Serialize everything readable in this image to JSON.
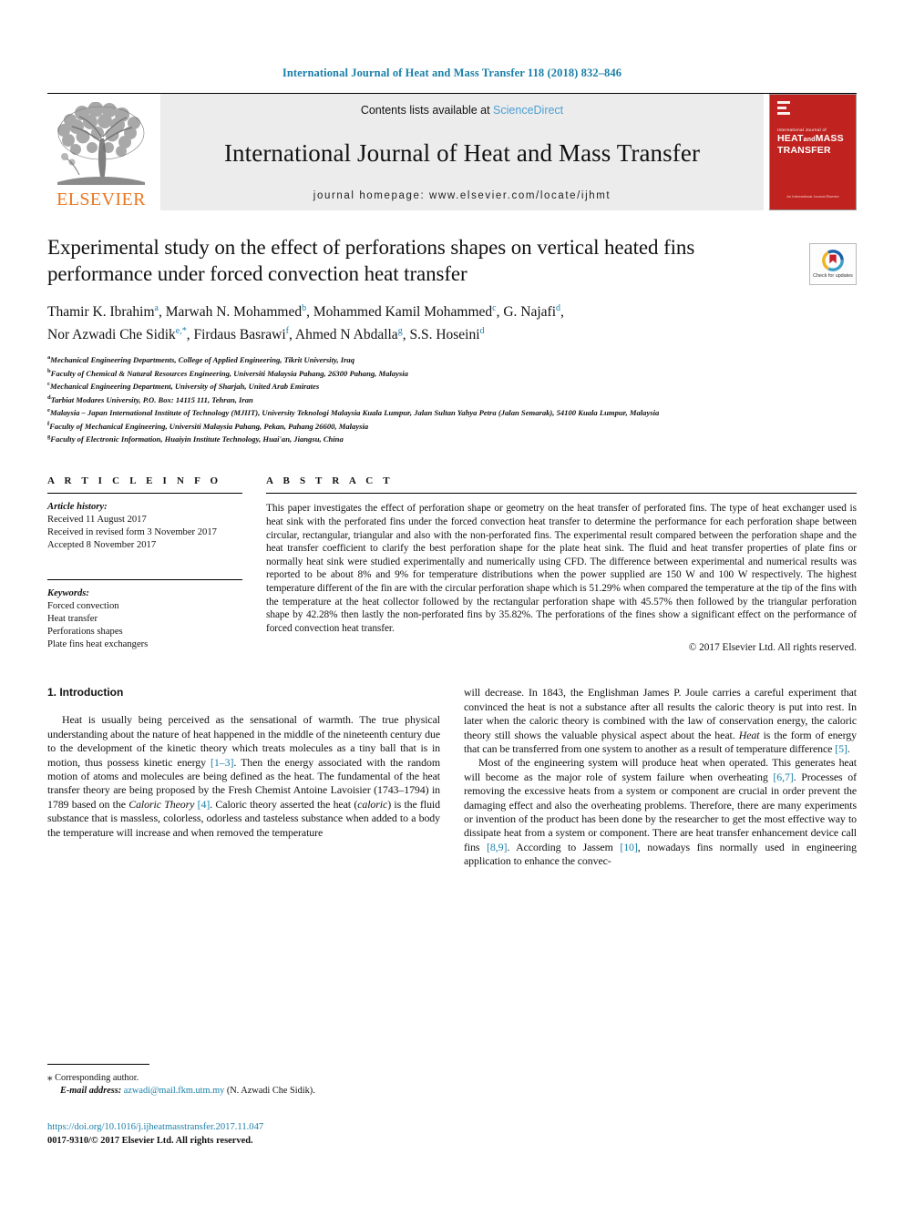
{
  "running_head": "International Journal of Heat and Mass Transfer 118 (2018) 832–846",
  "masthead": {
    "contents_prefix": "Contents lists available at ",
    "sciencedirect": "ScienceDirect",
    "journal_title": "International Journal of Heat and Mass Transfer",
    "homepage": "journal homepage: www.elsevier.com/locate/ijhmt",
    "publisher_logo_text": "ELSEVIER",
    "cover": {
      "small_line": "International Journal of",
      "line1": "HEAT",
      "line1b": "and",
      "line1c": "MASS",
      "line2": "TRANSFER",
      "footer": "An International Journal\nElsevier"
    }
  },
  "article": {
    "title": "Experimental study on the effect of perforations shapes on vertical heated fins performance under forced convection heat transfer",
    "crossmark_label": "Check for\nupdates",
    "authors": [
      {
        "name": "Thamir K. Ibrahim",
        "sup": "a"
      },
      {
        "name": "Marwah N. Mohammed",
        "sup": "b"
      },
      {
        "name": "Mohammed Kamil Mohammed",
        "sup": "c"
      },
      {
        "name": "G. Najafi",
        "sup": "d"
      },
      {
        "name": "Nor Azwadi Che Sidik",
        "sup": "e,*"
      },
      {
        "name": "Firdaus Basrawi",
        "sup": "f"
      },
      {
        "name": "Ahmed N Abdalla",
        "sup": "g"
      },
      {
        "name": "S.S. Hoseini",
        "sup": "d"
      }
    ],
    "affiliations": [
      {
        "mark": "a",
        "text": "Mechanical Engineering Departments, College of Applied Engineering, Tikrit University, Iraq"
      },
      {
        "mark": "b",
        "text": "Faculty of Chemical & Natural Resources Engineering, Universiti Malaysia Pahang, 26300 Pahang, Malaysia"
      },
      {
        "mark": "c",
        "text": "Mechanical Engineering Department, University of Sharjah, United Arab Emirates"
      },
      {
        "mark": "d",
        "text": "Tarbiat Modares University, P.O. Box: 14115 111, Tehran, Iran"
      },
      {
        "mark": "e",
        "text": "Malaysia – Japan International Institute of Technology (MJIIT), University Teknologi Malaysia Kuala Lumpur, Jalan Sultan Yahya Petra (Jalan Semarak), 54100 Kuala Lumpur, Malaysia"
      },
      {
        "mark": "f",
        "text": "Faculty of Mechanical Engineering, Universiti Malaysia Pahang, Pekan, Pahang 26600, Malaysia"
      },
      {
        "mark": "g",
        "text": "Faculty of Electronic Information, Huaiyin Institute Technology, Huai'an, Jiangsu, China"
      }
    ]
  },
  "article_info": {
    "heading": "A R T I C L E   I N F O",
    "history_label": "Article history:",
    "history": [
      "Received 11 August 2017",
      "Received in revised form 3 November 2017",
      "Accepted 8 November 2017"
    ],
    "keywords_label": "Keywords:",
    "keywords": [
      "Forced convection",
      "Heat transfer",
      "Perforations shapes",
      "Plate fins heat exchangers"
    ]
  },
  "abstract": {
    "heading": "A B S T R A C T",
    "text": "This paper investigates the effect of perforation shape or geometry on the heat transfer of perforated fins. The type of heat exchanger used is heat sink with the perforated fins under the forced convection heat transfer to determine the performance for each perforation shape between circular, rectangular, triangular and also with the non-perforated fins. The experimental result compared between the perforation shape and the heat transfer coefficient to clarify the best perforation shape for the plate heat sink. The fluid and heat transfer properties of plate fins or normally heat sink were studied experimentally and numerically using CFD. The difference between experimental and numerical results was reported to be about 8% and 9% for temperature distributions when the power supplied are 150 W and 100 W respectively. The highest temperature different of the fin are with the circular perforation shape which is 51.29% when compared the temperature at the tip of the fins with the temperature at the heat collector followed by the rectangular perforation shape with 45.57% then followed by the triangular perforation shape by 42.28% then lastly the non-perforated fins by 35.82%. The perforations of the fines show a significant effect on the performance of forced convection heat transfer.",
    "copyright": "© 2017 Elsevier Ltd. All rights reserved."
  },
  "introduction": {
    "section_number_title": "1. Introduction",
    "left_para1_a": "Heat is usually being perceived as the sensational of warmth. The true physical understanding about the nature of heat happened in the middle of the nineteenth century due to the development of the kinetic theory which treats molecules as a tiny ball that is in motion, thus possess kinetic energy ",
    "left_ref1": "[1–3]",
    "left_para1_b": ". Then the energy associated with the random motion of atoms and molecules are being defined as the heat. The fundamental of the heat transfer theory are being proposed by the Fresh Chemist Antoine Lavoisier (1743–1794) in 1789 based on the ",
    "left_italic1": "Caloric Theory",
    "left_ref2": "[4]",
    "left_para1_c": ". Caloric theory asserted the heat (",
    "left_italic2": "caloric",
    "left_para1_d": ") is the fluid substance that is massless, colorless, odorless and tasteless substance when added to a body the temperature will increase and when removed the temperature",
    "right_para1_a": "will decrease. In 1843, the Englishman James P. Joule carries a careful experiment that convinced the heat is not a substance after all results the caloric theory is put into rest. In later when the caloric theory is combined with the law of conservation energy, the caloric theory still shows the valuable physical aspect about the heat. ",
    "right_italic1": "Heat",
    "right_para1_b": " is the form of energy that can be transferred from one system to another as a result of temperature difference ",
    "right_ref1": "[5]",
    "right_para1_c": ".",
    "right_para2_a": "Most of the engineering system will produce heat when operated. This generates heat will become as the major role of system failure when overheating ",
    "right_ref2": "[6,7]",
    "right_para2_b": ". Processes of removing the excessive heats from a system or component are crucial in order prevent the damaging effect and also the overheating problems. Therefore, there are many experiments or invention of the product has been done by the researcher to get the most effective way to dissipate heat from a system or component. There are heat transfer enhancement device call fins ",
    "right_ref3": "[8,9]",
    "right_para2_c": ". According to Jassem ",
    "right_ref4": "[10]",
    "right_para2_d": ", nowadays fins normally used in engineering application to enhance the convec-"
  },
  "footer": {
    "corresponding_marker": "⁎",
    "corresponding_text": "Corresponding author.",
    "email_label": "E-mail address:",
    "email": "azwadi@mail.fkm.utm.my",
    "email_owner": "(N. Azwadi Che Sidik).",
    "doi": "https://doi.org/10.1016/j.ijheatmasstransfer.2017.11.047",
    "issn_line": "0017-9310/© 2017 Elsevier Ltd. All rights reserved."
  },
  "colors": {
    "link_blue": "#1a7fa8",
    "sciencedirect_blue": "#4a9fd4",
    "elsevier_orange": "#E87722",
    "cover_red": "#c0231f"
  }
}
